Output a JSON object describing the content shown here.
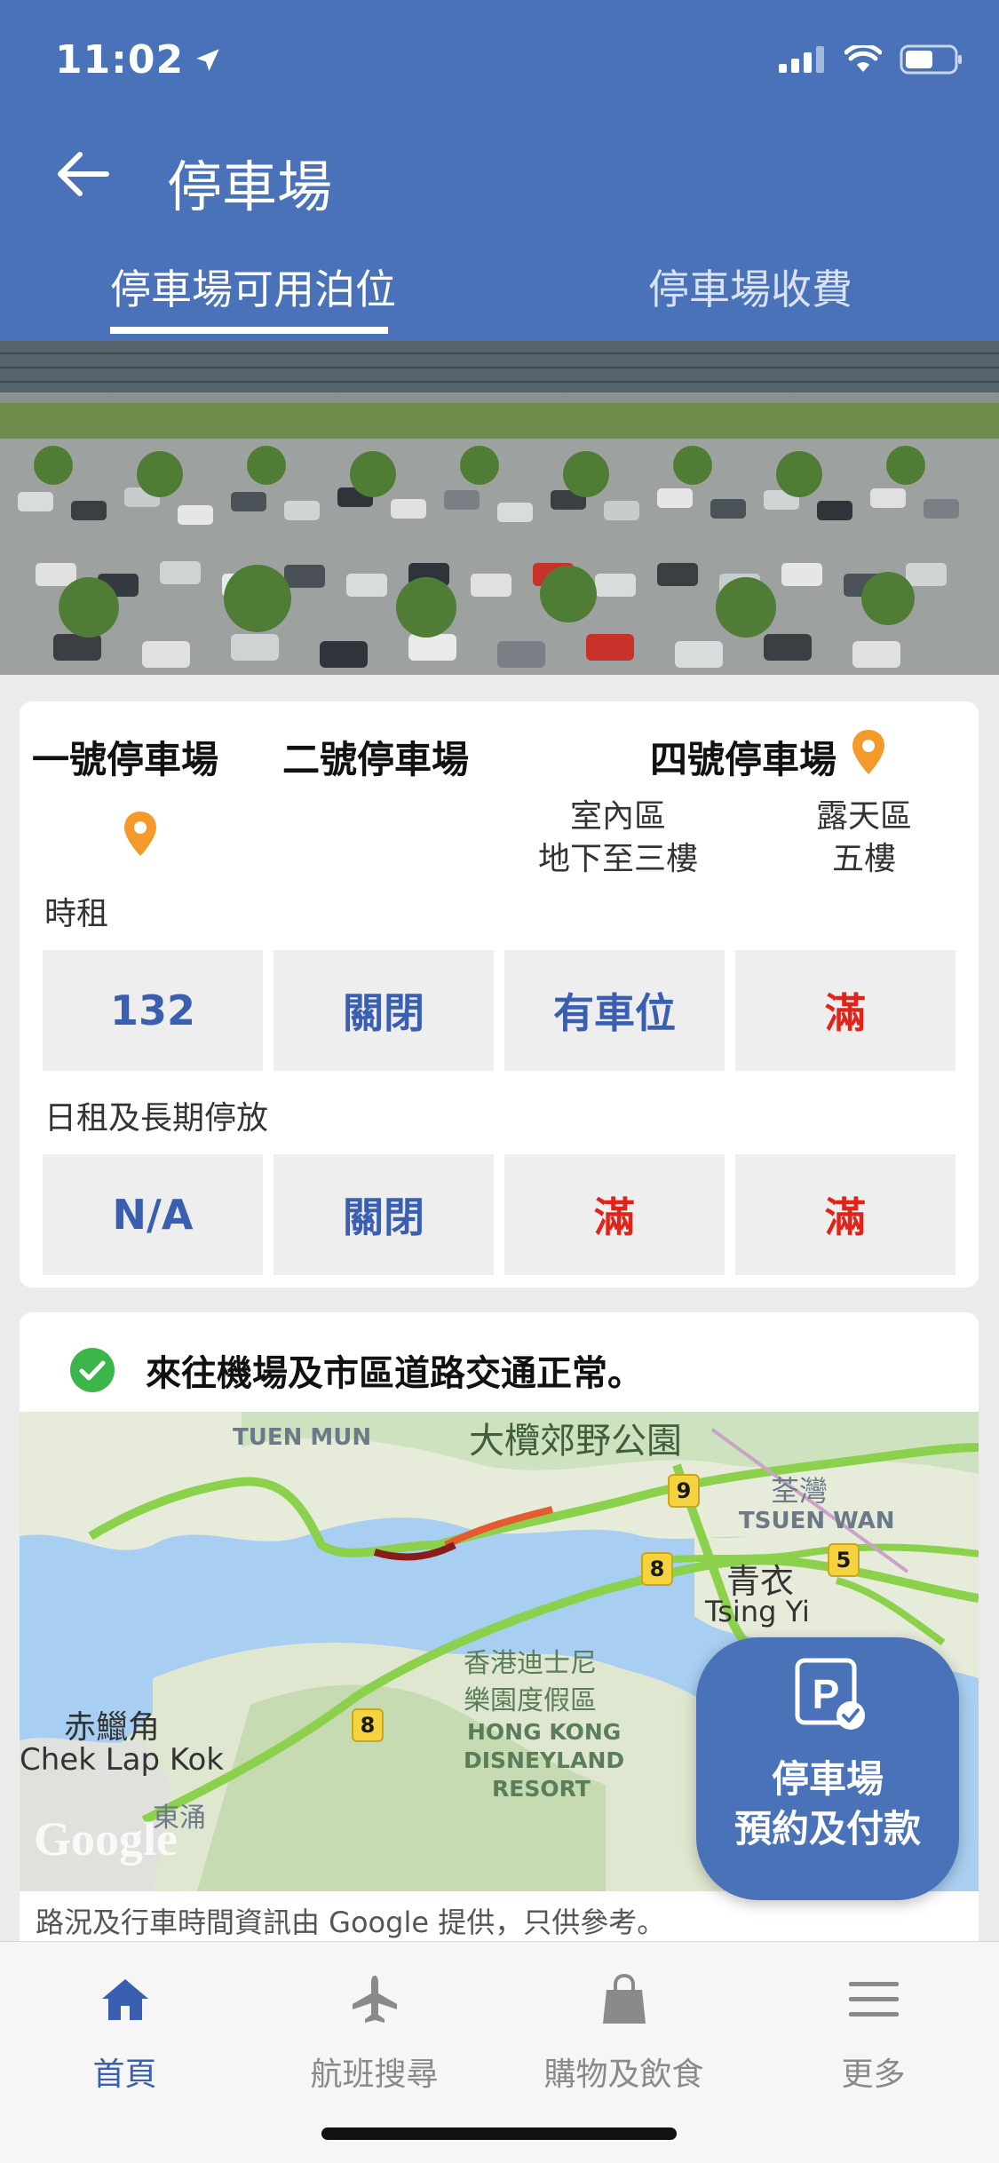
{
  "status_bar": {
    "time": "11:02"
  },
  "header": {
    "title": "停車場"
  },
  "tabs": [
    {
      "label": "停車場可用泊位",
      "active": true
    },
    {
      "label": "停車場收費",
      "active": false
    }
  ],
  "parking": {
    "lots": {
      "lot1": "一號停車場",
      "lot2": "二號停車場",
      "lot4": "四號停車場"
    },
    "zones": {
      "indoor_line1": "室內區",
      "indoor_line2": "地下至三樓",
      "outdoor_line1": "露天區",
      "outdoor_line2": "五樓"
    },
    "hourly": {
      "label": "時租",
      "values": [
        "132",
        "關閉",
        "有車位",
        "滿"
      ]
    },
    "daily": {
      "label": "日租及長期停放",
      "values": [
        "N/A",
        "關閉",
        "滿",
        "滿"
      ]
    }
  },
  "traffic": {
    "status_text": "來往機場及市區道路交通正常。",
    "map_labels": {
      "tuen_mun": "TUEN MUN",
      "tai_lam": "大欖郊野公園",
      "tsuen_wan_zh": "荃灣",
      "tsuen_wan_en": "TSUEN WAN",
      "tsing_yi_zh": "青衣",
      "tsing_yi_en": "Tsing Yi",
      "disney_zh1": "香港迪士尼",
      "disney_zh2": "樂園度假區",
      "disney_en1": "HONG KONG",
      "disney_en2": "DISNEYLAND",
      "disney_en3": "RESORT",
      "clk_zh": "赤鱲角",
      "clk_en": "Chek Lap Kok",
      "tung_chung": "東涌",
      "google": "Google",
      "route_9": "9",
      "route_8a": "8",
      "route_8b": "8",
      "route_5": "5"
    },
    "caption": "路況及行車時間資訊由 Google 提供，只供參考。"
  },
  "fab": {
    "line1": "停車場",
    "line2": "預約及付款"
  },
  "bottom_nav": [
    {
      "label": "首頁",
      "icon": "home-icon",
      "active": true
    },
    {
      "label": "航班搜尋",
      "icon": "plane-icon",
      "active": false
    },
    {
      "label": "購物及飲食",
      "icon": "shopping-bag-icon",
      "active": false
    },
    {
      "label": "更多",
      "icon": "menu-icon",
      "active": false
    }
  ],
  "colors": {
    "primary": "#4a72b9",
    "value_blue": "#3b5fb0",
    "value_red": "#e2231a",
    "pin_orange": "#f39a2b",
    "status_green": "#3cb54a"
  }
}
